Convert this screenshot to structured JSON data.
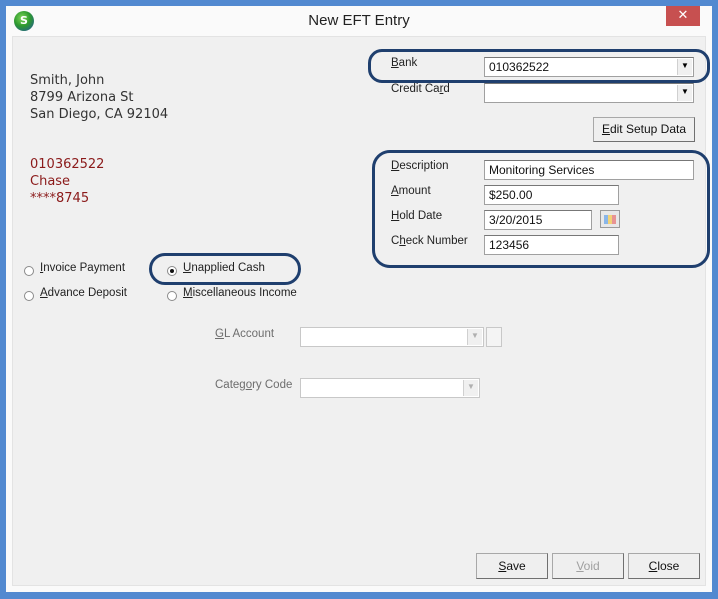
{
  "window": {
    "title": "New EFT Entry",
    "close_glyph": "✕",
    "app_icon_letter": "S"
  },
  "customer": {
    "name": "Smith, John",
    "street": "8799 Arizona St",
    "city_state_zip": "San Diego, CA  92104"
  },
  "bank_info": {
    "routing": "010362522",
    "bank_name": "Chase",
    "account_masked": "****8745"
  },
  "fields": {
    "bank": {
      "label_u": "B",
      "label_rest": "ank",
      "value": "010362522"
    },
    "credit_card": {
      "label_pre": "Credit Ca",
      "label_u": "r",
      "label_post": "d",
      "value": ""
    },
    "description": {
      "label_u": "D",
      "label_rest": "escription",
      "value": "Monitoring Services"
    },
    "amount": {
      "label_u": "A",
      "label_rest": "mount",
      "value": "$250.00"
    },
    "hold_date": {
      "label_u": "H",
      "label_rest": "old Date",
      "value": "3/20/2015"
    },
    "check_number": {
      "label_pre": "C",
      "label_u": "h",
      "label_post": "eck Number",
      "value": "123456"
    },
    "gl_account": {
      "label_u": "G",
      "label_rest": "L Account",
      "value": ""
    },
    "category_code": {
      "label_pre": "Categ",
      "label_u": "o",
      "label_post": "ry Code",
      "value": ""
    }
  },
  "payment_type": {
    "options": [
      {
        "label_u": "I",
        "label_rest": "nvoice Payment",
        "selected": false
      },
      {
        "label_u": "U",
        "label_rest": "napplied Cash",
        "selected": true
      },
      {
        "label_u": "A",
        "label_rest": "dvance Deposit",
        "selected": false
      },
      {
        "label_u": "M",
        "label_rest": "iscellaneous Income",
        "selected": false
      }
    ]
  },
  "buttons": {
    "edit_setup": {
      "u": "E",
      "rest": "dit Setup Data"
    },
    "save": {
      "u": "S",
      "rest": "ave"
    },
    "void": {
      "u": "V",
      "rest": "oid",
      "disabled": true
    },
    "close": {
      "u": "C",
      "rest": "lose"
    }
  },
  "icons": {
    "dropdown": "▼",
    "calendar": "calendar-icon"
  },
  "colors": {
    "accent_border": "#5289d0",
    "highlight_oval": "#1f3f6e",
    "bank_text": "#8b1a1a",
    "close_button": "#c75050"
  }
}
